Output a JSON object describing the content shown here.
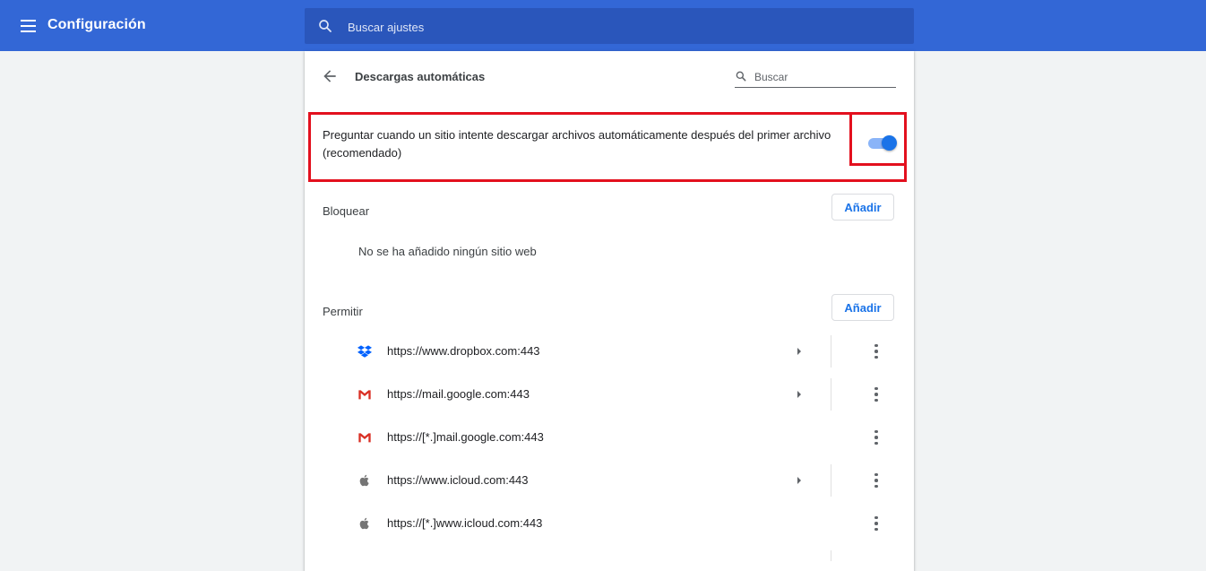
{
  "header": {
    "title": "Configuración",
    "search_placeholder": "Buscar ajustes",
    "menu_icon": "hamburger-menu-icon",
    "search_icon": "search-icon",
    "background_color": "#3367d6"
  },
  "page": {
    "title": "Descargas automáticas",
    "search_placeholder": "Buscar",
    "back_icon": "arrow-back-icon"
  },
  "ask_setting": {
    "label": "Preguntar cuando un sitio intente descargar archivos automáticamente después del primer archivo (recomendado)",
    "enabled": true,
    "highlight_color": "#e3101e",
    "toggle_color": "#1a73e8"
  },
  "block_section": {
    "label": "Bloquear",
    "add_label": "Añadir",
    "empty_message": "No se ha añadido ningún sitio web"
  },
  "allow_section": {
    "label": "Permitir",
    "add_label": "Añadir",
    "sites": [
      {
        "url": "https://www.dropbox.com:443",
        "icon": "dropbox-icon",
        "has_arrow": true
      },
      {
        "url": "https://mail.google.com:443",
        "icon": "gmail-icon",
        "has_arrow": true
      },
      {
        "url": "https://[*.]mail.google.com:443",
        "icon": "gmail-icon",
        "has_arrow": false
      },
      {
        "url": "https://www.icloud.com:443",
        "icon": "apple-icon",
        "has_arrow": true
      },
      {
        "url": "https://[*.]www.icloud.com:443",
        "icon": "apple-icon",
        "has_arrow": false
      }
    ]
  }
}
